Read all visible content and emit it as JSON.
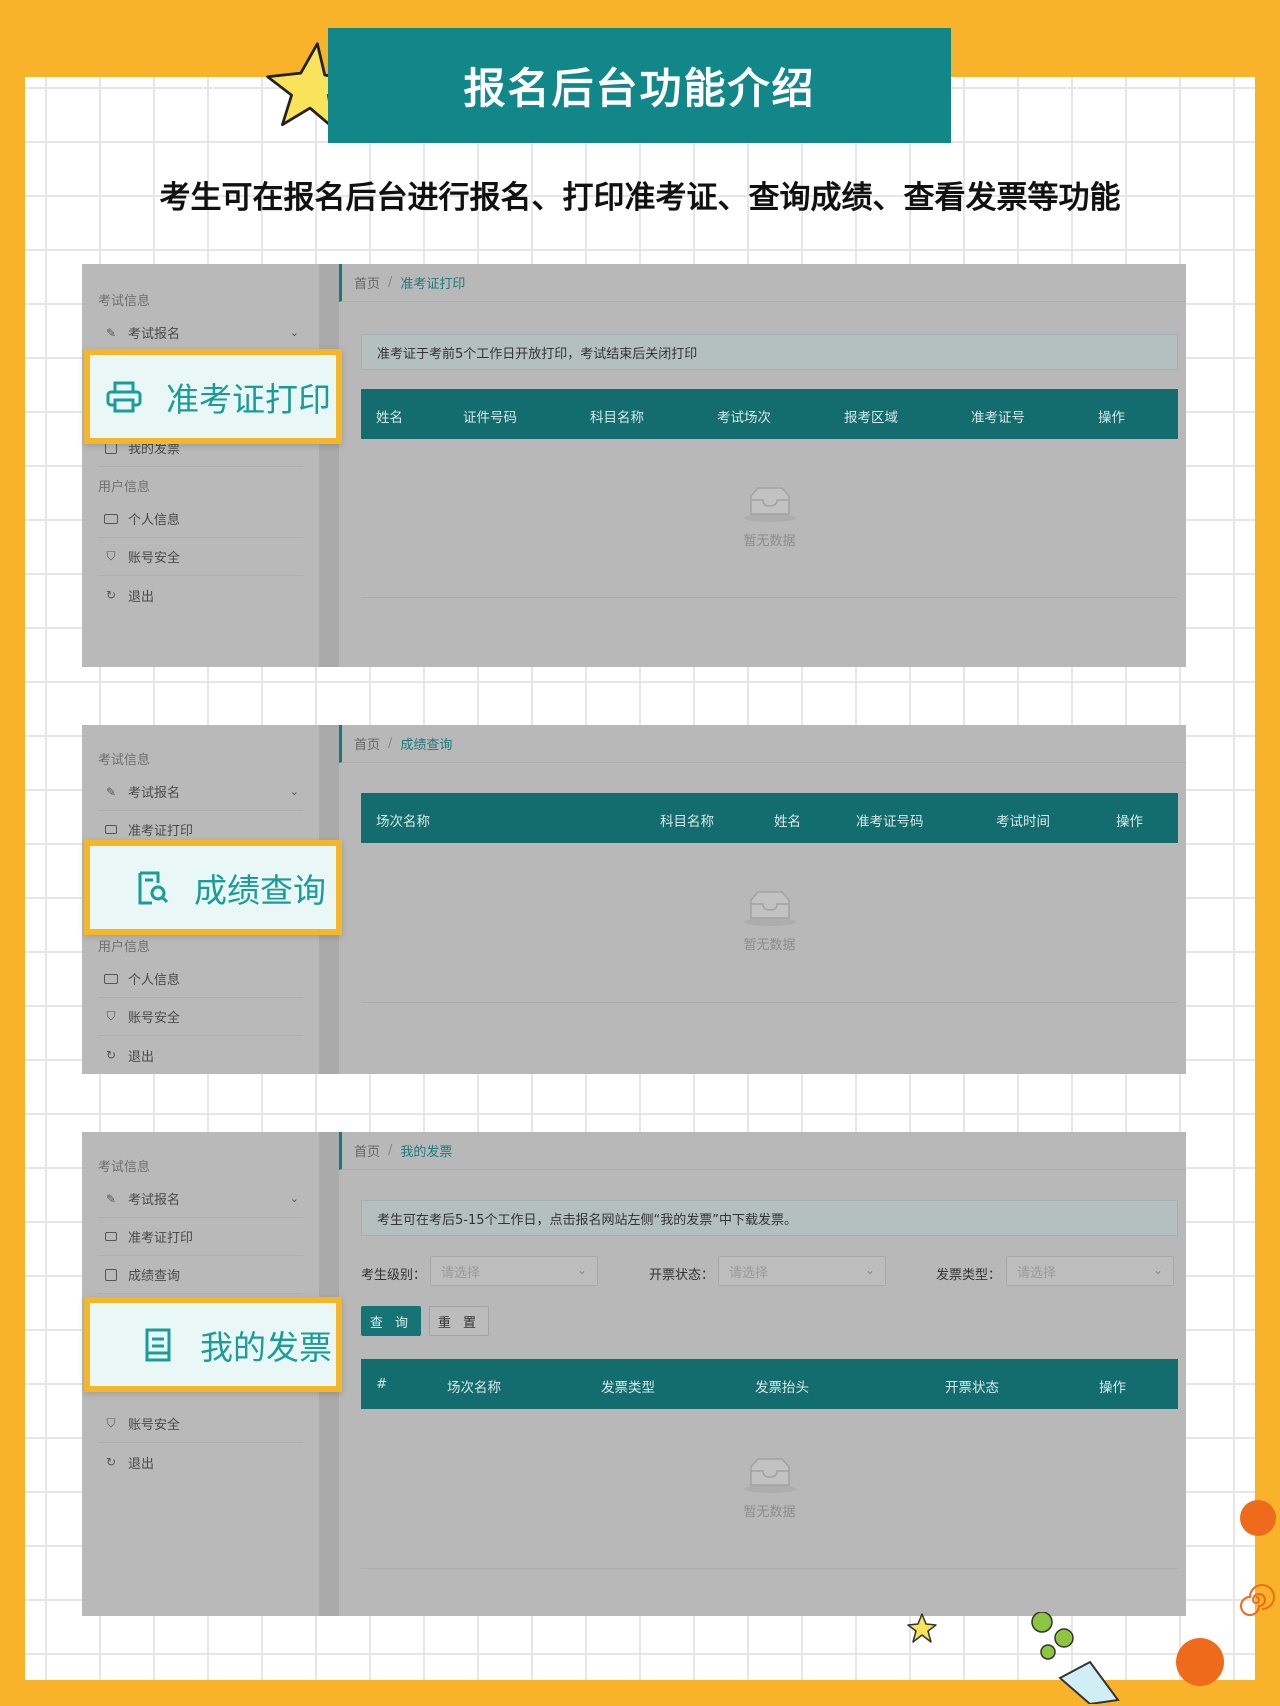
{
  "header": {
    "title": "报名后台功能介绍",
    "subtitle": "考生可在报名后台进行报名、打印准考证、查询成绩、查看发票等功能"
  },
  "colors": {
    "accent": "#11878a",
    "frame": "#f8b32a",
    "table_header": "#136c6e"
  },
  "panel1": {
    "sidebar": {
      "section1": "考试信息",
      "items": [
        "考试报名",
        "我的发票"
      ],
      "section2": "用户信息",
      "items2": [
        "个人信息",
        "账号安全",
        "退出"
      ]
    },
    "breadcrumb": {
      "home": "首页",
      "sep": "/",
      "current": "准考证打印"
    },
    "notice": "准考证于考前5个工作日开放打印，考试结束后关闭打印",
    "columns": [
      "姓名",
      "证件号码",
      "科目名称",
      "考试场次",
      "报考区域",
      "准考证号",
      "操作"
    ],
    "empty": "暂无数据",
    "callout": "准考证打印"
  },
  "panel2": {
    "sidebar": {
      "section1": "考试信息",
      "items": [
        "考试报名",
        "准考证打印"
      ],
      "section2": "用户信息",
      "items2": [
        "个人信息",
        "账号安全",
        "退出"
      ]
    },
    "breadcrumb": {
      "home": "首页",
      "sep": "/",
      "current": "成绩查询"
    },
    "columns": [
      "场次名称",
      "科目名称",
      "姓名",
      "准考证号码",
      "考试时间",
      "操作"
    ],
    "empty": "暂无数据",
    "callout": "成绩查询"
  },
  "panel3": {
    "sidebar": {
      "section1": "考试信息",
      "items": [
        "考试报名",
        "准考证打印",
        "成绩查询"
      ],
      "items2": [
        "账号安全",
        "退出"
      ]
    },
    "breadcrumb": {
      "home": "首页",
      "sep": "/",
      "current": "我的发票"
    },
    "notice": "考生可在考后5-15个工作日，点击报名网站左侧“我的发票”中下载发票。",
    "filters": [
      {
        "label": "考生级别：",
        "placeholder": "请选择"
      },
      {
        "label": "开票状态：",
        "placeholder": "请选择"
      },
      {
        "label": "发票类型：",
        "placeholder": "请选择"
      }
    ],
    "query_button": "查 询",
    "reset_button": "重 置",
    "columns": [
      "#",
      "场次名称",
      "发票类型",
      "发票抬头",
      "开票状态",
      "操作"
    ],
    "empty": "暂无数据",
    "callout": "我的发票"
  }
}
